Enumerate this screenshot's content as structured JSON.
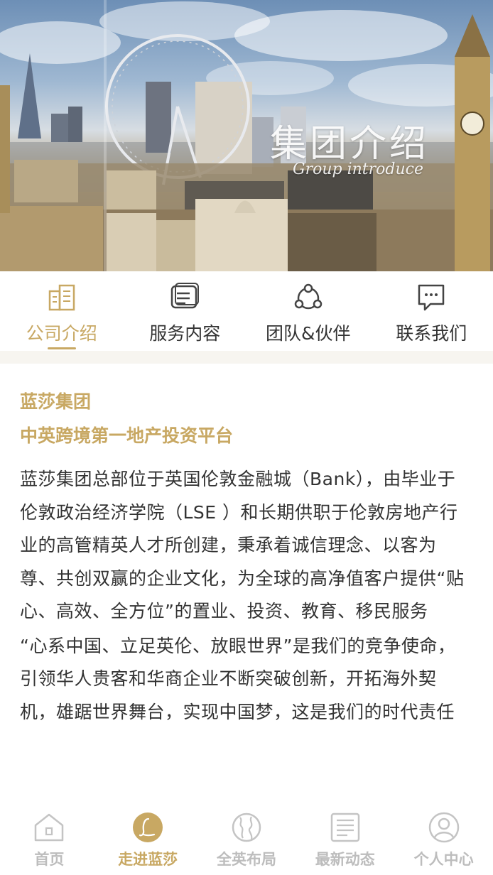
{
  "hero": {
    "title": "集团介绍",
    "subtitle": "Group introduce"
  },
  "tabs": [
    {
      "label": "公司介绍",
      "icon": "building-icon",
      "active": true
    },
    {
      "label": "服务内容",
      "icon": "document-list-icon",
      "active": false
    },
    {
      "label": "团队&伙伴",
      "icon": "team-icon",
      "active": false
    },
    {
      "label": "联系我们",
      "icon": "chat-icon",
      "active": false
    }
  ],
  "content": {
    "heading_line1": "蓝莎集团",
    "heading_line2": "中英跨境第一地产投资平台",
    "paragraph1": "蓝莎集团总部位于英国伦敦金融城（Bank），由毕业于伦敦政治经济学院（LSE ）和长期供职于伦敦房地产行业的高管精英人才所创建，秉承着诚信理念、以客为尊、共创双赢的企业文化，为全球的高净值客户提供“贴心、高效、全方位”的置业、投资、教育、移民服务",
    "paragraph2": "“心系中国、立足英伦、放眼世界”是我们的竞争使命，引领华人贵客和华商企业不断突破创新，开拓海外契机，雄踞世界舞台，实现中国梦，这是我们的时代责任"
  },
  "bottom_nav": [
    {
      "label": "首页",
      "icon": "home-icon",
      "active": false
    },
    {
      "label": "走进蓝莎",
      "icon": "brand-logo-icon",
      "active": true
    },
    {
      "label": "全英布局",
      "icon": "globe-icon",
      "active": false
    },
    {
      "label": "最新动态",
      "icon": "news-icon",
      "active": false
    },
    {
      "label": "个人中心",
      "icon": "user-icon",
      "active": false
    }
  ],
  "colors": {
    "accent": "#c8a863",
    "text": "#333333",
    "inactive": "#bdbdbd",
    "band": "#f7f5f0"
  }
}
